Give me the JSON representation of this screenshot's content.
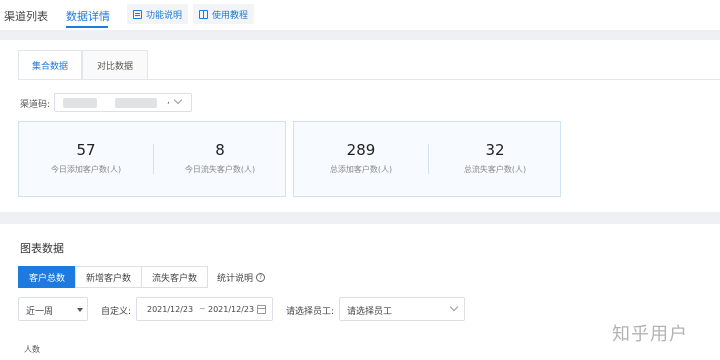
{
  "nav": {
    "tabs": [
      {
        "label": "渠道列表"
      },
      {
        "label": "数据详情"
      }
    ],
    "pills": [
      {
        "label": "功能说明"
      },
      {
        "label": "使用教程"
      }
    ]
  },
  "subtabs": [
    {
      "label": "集合数据"
    },
    {
      "label": "对比数据"
    }
  ],
  "channel": {
    "label": "渠道码:",
    "separator": ","
  },
  "stats": [
    {
      "value": "57",
      "label": "今日添加客户数(人)"
    },
    {
      "value": "8",
      "label": "今日流失客户数(人)"
    },
    {
      "value": "289",
      "label": "总添加客户数(人)"
    },
    {
      "value": "32",
      "label": "总流失客户数(人)"
    }
  ],
  "chart_section": {
    "title": "图表数据",
    "segments": [
      {
        "label": "客户总数"
      },
      {
        "label": "新增客户数"
      },
      {
        "label": "流失客户数"
      }
    ],
    "stat_note": "统计说明",
    "period": "近一周",
    "custom_label": "自定义:",
    "date_start": "2021/12/23",
    "date_tilde": "~",
    "date_end": "2021/12/23",
    "employee_label": "请选择员工:",
    "employee_placeholder": "请选择员工",
    "y_axis_label": "人数"
  },
  "watermark": "知乎用户",
  "colors": {
    "accent": "#1f7ae0",
    "panel_border": "#cfe3f3",
    "panel_bg": "#f7fbff"
  }
}
